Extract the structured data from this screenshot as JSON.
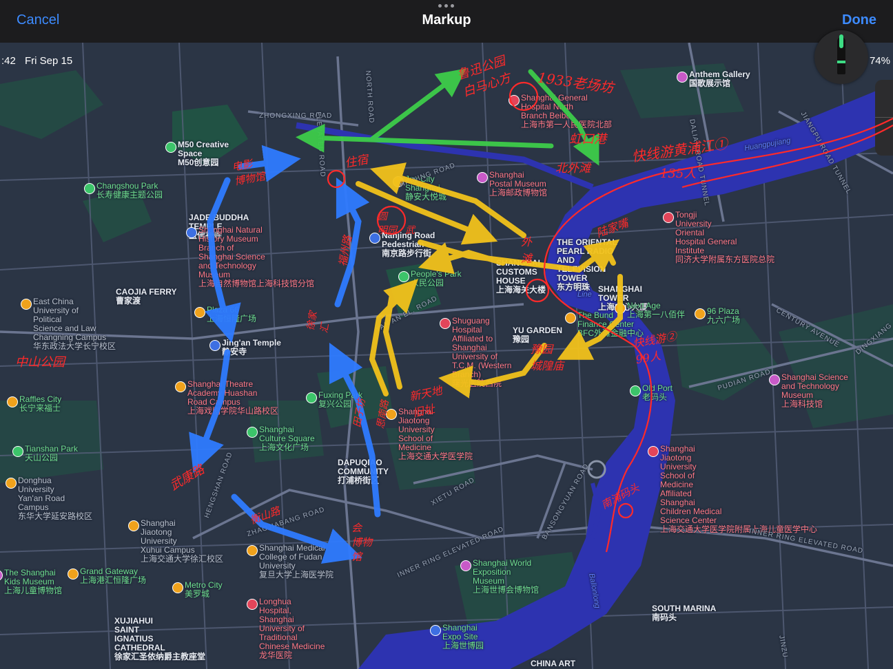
{
  "topbar": {
    "cancel": "Cancel",
    "title": "Markup",
    "done": "Done"
  },
  "status": {
    "time": ":42",
    "date": "Fri Sep 15",
    "battery": "74%"
  },
  "map": {
    "places": [
      {
        "id": "anthem",
        "text": "Anthem Gallery\n国歌展示馆"
      },
      {
        "id": "hospital-north",
        "text": "Shanghai General\nHospital North\nBranch Beibu\n上海市第一人民医院北部"
      },
      {
        "id": "m50",
        "text": "M50 Creative\nSpace\nM50创意园"
      },
      {
        "id": "changshou",
        "text": "Changshou Park\n长寿健康主题公园"
      },
      {
        "id": "jade",
        "text": "JADE BUDDHA\nTEMPLE\n玉佛禅寺"
      },
      {
        "id": "joy-city",
        "text": "Joy City\nShanghai\n静安大悦城"
      },
      {
        "id": "postal",
        "text": "Shanghai\nPostal Museum\n上海邮政博物馆"
      },
      {
        "id": "natural-history",
        "text": "Shanghai Natural\nHistory Museum\nBranch of\nShanghai Science\nand Technology\nMuseum\n上海自然博物馆上海科技馆分馆"
      },
      {
        "id": "nanjing-road",
        "text": "Nanjing Road\nPedestrian\n南京路步行街"
      },
      {
        "id": "peoples-park",
        "text": "People's Park\n人民公园"
      },
      {
        "id": "customs",
        "text": "SHANGHAI\nCUSTOMS\nHOUSE\n上海海关大楼"
      },
      {
        "id": "pearl",
        "text": "THE ORIENTAL\nPEARL RADIO\nAND\nTELEVISION\nTOWER\n东方明珠"
      },
      {
        "id": "tower",
        "text": "SHANGHAI\nTOWER\n上海中心大厦"
      },
      {
        "id": "tongji",
        "text": "Tongji\nUniversity\nOriental\nHospital General\nInstitute\n同济大学附属东方医院总院"
      },
      {
        "id": "caojia",
        "text": "CAOJIA FERRY\n曹家渡"
      },
      {
        "id": "ecupl",
        "text": "East China\nUniversity of\nPolitical\nScience and Law\nChangning Campus\n华东政法大学长宁校区"
      },
      {
        "id": "plaza66",
        "text": "Plaza 66\n上海恒隆广场"
      },
      {
        "id": "jingan",
        "text": "Jing'an Temple\n静安寺"
      },
      {
        "id": "shuguang",
        "text": "Shuguang\nHospital\nAffiliated to\nShanghai\nUniversity of\nT.C.M. (Western\nBranch)\n曙光医院西院"
      },
      {
        "id": "yu-garden",
        "text": "YU GARDEN\n豫园"
      },
      {
        "id": "bund-finance",
        "text": "The Bund\nFinance Center\nBFC外滩金融中心"
      },
      {
        "id": "next-age",
        "text": "Next Age\n上海第一八佰伴"
      },
      {
        "id": "96-plaza",
        "text": "96 Plaza\n九六广场"
      },
      {
        "id": "theatre",
        "text": "Shanghai Theatre\nAcademy Huashan\nRoad Campus\n上海戏剧学院华山路校区"
      },
      {
        "id": "raffles",
        "text": "Raffles City\n长宁来福士"
      },
      {
        "id": "fuxing",
        "text": "Fuxing Park\n复兴公园"
      },
      {
        "id": "old-port",
        "text": "Old Port\n老码头"
      },
      {
        "id": "sstm",
        "text": "Shanghai Science\nand Technology\nMuseum\n上海科技馆"
      },
      {
        "id": "tianshan",
        "text": "Tianshan Park\n天山公园"
      },
      {
        "id": "culture-sq",
        "text": "Shanghai\nCulture Square\n上海文化广场"
      },
      {
        "id": "jiaotong-med",
        "text": "Shanghai\nJiaotong\nUniversity\nSchool of\nMedicine\n上海交通大学医学院"
      },
      {
        "id": "donghua",
        "text": "Donghua\nUniversity\nYan'an Road\nCampus\n东华大学延安路校区"
      },
      {
        "id": "dapuqiao",
        "text": "DAPUQIAO\nCOMMUNITY\n打浦桥街区"
      },
      {
        "id": "jiaotong-child",
        "text": "Shanghai\nJiaotong\nUniversity\nSchool of\nMedicine\nAffiliated\nShanghai\nChildren Medical\nScience Center\n上海交通大学医学院附属上海儿童医学中心"
      },
      {
        "id": "xuhui",
        "text": "Shanghai\nJiaotong\nUniversity\nXuhui Campus\n上海交通大学徐汇校区"
      },
      {
        "id": "fudan-med",
        "text": "Shanghai Medical\nCollege of Fudan\nUniversity\n复旦大学上海医学院"
      },
      {
        "id": "expo-museum",
        "text": "Shanghai World\nExposition\nMuseum\n上海世博会博物馆"
      },
      {
        "id": "kids-museum",
        "text": "The Shanghai\nKids Museum\n上海儿童博物馆"
      },
      {
        "id": "grand-gateway",
        "text": "Grand Gateway\n上海港汇恒隆广场"
      },
      {
        "id": "metro-city",
        "text": "Metro City\n美罗城"
      },
      {
        "id": "south-marina",
        "text": "SOUTH MARINA\n南码头"
      },
      {
        "id": "longhua",
        "text": "Longhua\nHospital,\nShanghai\nUniversity of\nTraditional\nChinese Medicine\n龙华医院"
      },
      {
        "id": "xujiahui",
        "text": "XUJIAHUI\nSAINT\nIGNATIUS\nCATHEDRAL\n徐家汇圣依纳爵主教座堂"
      },
      {
        "id": "expo-site",
        "text": "Shanghai\nExpo Site\n上海世博园"
      },
      {
        "id": "china-art",
        "text": "CHINA ART"
      }
    ],
    "roads": {
      "zhongxing": "ZHONGXING ROAD",
      "elevated": "ELEVATED ROAD",
      "north": "NORTH ROAD",
      "haining": "HAINING ROAD",
      "dalian": "DALIAN ROAD TUNNEL",
      "jiangpu": "JIANGPU ROAD TUNNEL",
      "yanan": "YAN'AN EL. ROAD",
      "century": "CENTURY AVENUE",
      "pudian": "PUDIAN ROAD",
      "dingxiang": "DINGXIANG",
      "hengshan": "HENGSHAN ROAD",
      "zhaojiabang": "ZHAOJIABANG ROAD",
      "xietu": "XIETU ROAD",
      "inner-ring": "INNER RING ELEVATED ROAD",
      "inner-ring-2": "INNER RING ELEVATED ROAD",
      "bansongyuan": "BANSONGYUAN ROAD",
      "jinzu": "JINZU"
    },
    "river_labels": {
      "huangpujiang": "Huangpujiang",
      "line": "Line",
      "ballonlong": "Ballonlong"
    }
  },
  "annotations": {
    "handwriting": [
      {
        "id": "hw-a",
        "text": "鲁迅公园\n白马心方"
      },
      {
        "id": "hw-b",
        "text": "1933老场坊"
      },
      {
        "id": "hw-c",
        "text": "虹口港"
      },
      {
        "id": "hw-d",
        "text": "北外滩"
      },
      {
        "id": "hw-e",
        "text": "快线游黄浦江①"
      },
      {
        "id": "hw-f",
        "text": "135人"
      },
      {
        "id": "hw-g",
        "text": "电影\n博物馆"
      },
      {
        "id": "hw-h",
        "text": "住宿"
      },
      {
        "id": "hw-i",
        "text": "福州路"
      },
      {
        "id": "hw-j",
        "text": "外\n滩"
      },
      {
        "id": "hw-k",
        "text": "陆家嘴"
      },
      {
        "id": "hw-l",
        "text": "快线游②\n99人"
      },
      {
        "id": "hw-m",
        "text": "豫园\n城隍庙"
      },
      {
        "id": "hw-n",
        "text": "新天地\n旧址"
      },
      {
        "id": "hw-o",
        "text": "中山公园"
      },
      {
        "id": "hw-p",
        "text": "武康路"
      },
      {
        "id": "hw-q",
        "text": "衡山路"
      },
      {
        "id": "hw-r",
        "text": "徐家\n汇"
      },
      {
        "id": "hw-s",
        "text": "田子坊"
      },
      {
        "id": "hw-t",
        "text": "思南路"
      },
      {
        "id": "hw-u",
        "text": "会\n博物\n馆"
      },
      {
        "id": "hw-v",
        "text": "南浦码头"
      },
      {
        "id": "hw-w",
        "text": "圆\n明园"
      },
      {
        "id": "hw-x",
        "text": "武"
      }
    ],
    "colors": {
      "green": "#3dcc4a",
      "yellow": "#f2c21b",
      "blue": "#2f7bff",
      "red": "#ff2a2a"
    }
  }
}
